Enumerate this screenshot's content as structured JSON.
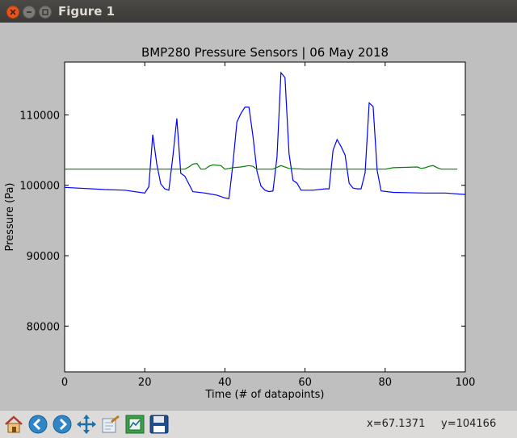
{
  "window": {
    "title": "Figure 1"
  },
  "toolbar": {
    "buttons": [
      {
        "name": "home-button",
        "icon": "home-icon"
      },
      {
        "name": "back-button",
        "icon": "arrow-left-icon"
      },
      {
        "name": "forward-button",
        "icon": "arrow-right-icon"
      },
      {
        "name": "pan-button",
        "icon": "move-arrows-icon"
      },
      {
        "name": "zoom-button",
        "icon": "zoom-rect-icon"
      },
      {
        "name": "configure-subplots-button",
        "icon": "subplots-icon"
      },
      {
        "name": "save-button",
        "icon": "floppy-disk-icon"
      }
    ],
    "coord_x": "x=67.1371",
    "coord_y": "y=104166"
  },
  "colors": {
    "series1": "#0000ff",
    "series2": "#008000"
  },
  "chart_data": {
    "type": "line",
    "title": "BMP280 Pressure Sensors | 06 May 2018",
    "xlabel": "Time (# of datapoints)",
    "ylabel": "Pressure (Pa)",
    "xlim": [
      0,
      100
    ],
    "ylim": [
      73500,
      117500
    ],
    "xticks": [
      0,
      20,
      40,
      60,
      80,
      100
    ],
    "yticks": [
      80000,
      90000,
      100000,
      110000
    ],
    "xtick_labels": [
      "0",
      "20",
      "40",
      "60",
      "80",
      "100"
    ],
    "ytick_labels": [
      "80000",
      "90000",
      "100000",
      "110000"
    ],
    "grid": false,
    "series": [
      {
        "color": "#0000ff",
        "points": [
          [
            0,
            99700
          ],
          [
            10,
            99400
          ],
          [
            15,
            99300
          ],
          [
            20,
            98900
          ],
          [
            21,
            99800
          ],
          [
            22,
            107200
          ],
          [
            23,
            103000
          ],
          [
            24,
            100200
          ],
          [
            25,
            99500
          ],
          [
            26,
            99300
          ],
          [
            27,
            104000
          ],
          [
            28,
            109500
          ],
          [
            29,
            101700
          ],
          [
            30,
            101300
          ],
          [
            32,
            99100
          ],
          [
            35,
            98900
          ],
          [
            38,
            98600
          ],
          [
            40,
            98200
          ],
          [
            41,
            98100
          ],
          [
            42,
            103000
          ],
          [
            43,
            109000
          ],
          [
            44,
            110200
          ],
          [
            45,
            111100
          ],
          [
            46,
            111100
          ],
          [
            47,
            107000
          ],
          [
            48,
            102000
          ],
          [
            49,
            99900
          ],
          [
            50,
            99300
          ],
          [
            51,
            99100
          ],
          [
            52,
            99200
          ],
          [
            53,
            104000
          ],
          [
            54,
            116000
          ],
          [
            55,
            115300
          ],
          [
            56,
            104500
          ],
          [
            57,
            100700
          ],
          [
            58,
            100300
          ],
          [
            59,
            99300
          ],
          [
            62,
            99300
          ],
          [
            65,
            99500
          ],
          [
            66,
            99500
          ],
          [
            67,
            105000
          ],
          [
            68,
            106500
          ],
          [
            69,
            105500
          ],
          [
            70,
            104300
          ],
          [
            71,
            100300
          ],
          [
            72,
            99600
          ],
          [
            73,
            99500
          ],
          [
            74,
            99500
          ],
          [
            75,
            101800
          ],
          [
            76,
            111700
          ],
          [
            77,
            111200
          ],
          [
            78,
            102100
          ],
          [
            79,
            99200
          ],
          [
            82,
            99000
          ],
          [
            90,
            98900
          ],
          [
            95,
            98900
          ],
          [
            100,
            98700
          ]
        ]
      },
      {
        "color": "#008000",
        "points": [
          [
            0,
            102300
          ],
          [
            30,
            102300
          ],
          [
            31,
            102600
          ],
          [
            32,
            103000
          ],
          [
            33,
            103100
          ],
          [
            34,
            102300
          ],
          [
            35,
            102300
          ],
          [
            36,
            102700
          ],
          [
            37,
            102900
          ],
          [
            39,
            102800
          ],
          [
            40,
            102300
          ],
          [
            41,
            102400
          ],
          [
            42,
            102500
          ],
          [
            44,
            102600
          ],
          [
            46,
            102800
          ],
          [
            47,
            102700
          ],
          [
            48,
            102300
          ],
          [
            52,
            102300
          ],
          [
            54,
            102800
          ],
          [
            56,
            102400
          ],
          [
            60,
            102300
          ],
          [
            80,
            102300
          ],
          [
            82,
            102500
          ],
          [
            88,
            102600
          ],
          [
            89,
            102400
          ],
          [
            90,
            102500
          ],
          [
            91,
            102700
          ],
          [
            92,
            102800
          ],
          [
            93,
            102500
          ],
          [
            94,
            102300
          ],
          [
            98,
            102300
          ]
        ]
      }
    ]
  }
}
